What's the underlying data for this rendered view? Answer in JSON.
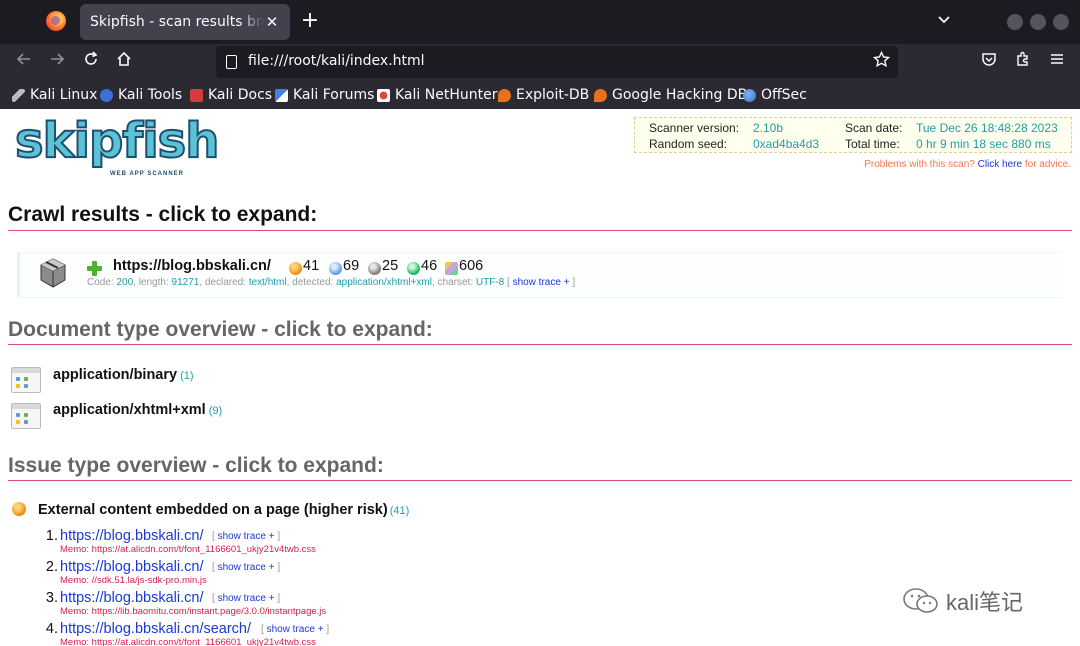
{
  "browser": {
    "tab_title": "Skipfish - scan results browser",
    "tab_close": "✕",
    "new_tab": "+",
    "url": "file:///root/kali/index.html",
    "bookmarks": [
      {
        "label": "Kali Linux",
        "icon": "kali-dragon-icon",
        "color": "#bbbbbb"
      },
      {
        "label": "Kali Tools",
        "icon": "kali-tools-icon",
        "color": "#3f6fd8"
      },
      {
        "label": "Kali Docs",
        "icon": "kali-docs-icon",
        "color": "#d23c3c"
      },
      {
        "label": "Kali Forums",
        "icon": "kali-forums-icon",
        "color": "#4a7fe0"
      },
      {
        "label": "Kali NetHunter",
        "icon": "kali-nethunter-icon",
        "color": "#e0463c"
      },
      {
        "label": "Exploit-DB",
        "icon": "exploit-db-icon",
        "color": "#e8701e"
      },
      {
        "label": "Google Hacking DB",
        "icon": "ghdb-icon",
        "color": "#e8701e"
      },
      {
        "label": "OffSec",
        "icon": "offsec-icon",
        "color": "#4a8fe6"
      }
    ]
  },
  "scan_info": {
    "version_label": "Scanner version:",
    "version": "2.10b",
    "date_label": "Scan date:",
    "date": "Tue Dec 26 18:48:28 2023",
    "seed_label": "Random seed:",
    "seed": "0xad4ba4d3",
    "time_label": "Total time:",
    "time": "0 hr 9 min 18 sec 880 ms",
    "problems_prefix": "Problems with this scan? ",
    "problems_link": "Click here",
    "problems_suffix": " for advice."
  },
  "logo": {
    "word": "skipfish",
    "tagline": "WEB APP SCANNER"
  },
  "sections": {
    "crawl": "Crawl results - click to expand:",
    "doctype": "Document type overview - click to expand:",
    "issue": "Issue type overview - click to expand:"
  },
  "crawl": {
    "url": "https://blog.bbskali.cn/",
    "counts": [
      {
        "value": "41",
        "color": "#f39a1a"
      },
      {
        "value": "69",
        "color": "#6fa7e8"
      },
      {
        "value": "25",
        "color": "#8a8a8a"
      },
      {
        "value": "46",
        "color": "#27c46a"
      },
      {
        "value": "606",
        "color": "#c9a0e0"
      }
    ],
    "meta": {
      "code_label": "Code: ",
      "code": "200",
      "length_label": ", length: ",
      "length": "91271",
      "declared_label": ", declared: ",
      "declared": "text/html",
      "detected_label": ", detected: ",
      "detected": "application/xhtml+xml",
      "charset_label": ", charset: ",
      "charset": "UTF-8",
      "trace_open": " [ ",
      "trace": "show trace +",
      "trace_close": " ]"
    }
  },
  "doc_types": [
    {
      "type": "application/binary",
      "count": "(1)"
    },
    {
      "type": "application/xhtml+xml",
      "count": "(9)"
    }
  ],
  "issue": {
    "title": "External content embedded on a page (higher risk)",
    "count": "(41)",
    "items": [
      {
        "num": "1.",
        "url": "https://blog.bbskali.cn/",
        "trace_open": "[ ",
        "trace": "show trace +",
        "trace_close": " ]",
        "memo": "Memo: https://at.alicdn.com/t/font_1166601_ukjy21v4twb.css"
      },
      {
        "num": "2.",
        "url": "https://blog.bbskali.cn/",
        "trace_open": "[ ",
        "trace": "show trace +",
        "trace_close": " ]",
        "memo": "Memo: //sdk.51.la/js-sdk-pro.min.js"
      },
      {
        "num": "3.",
        "url": "https://blog.bbskali.cn/",
        "trace_open": "[ ",
        "trace": "show trace +",
        "trace_close": " ]",
        "memo": "Memo: https://lib.baomitu.com/instant.page/3.0.0/instantpage.js"
      },
      {
        "num": "4.",
        "url": "https://blog.bbskali.cn/search/",
        "trace_open": "[ ",
        "trace": "show trace +",
        "trace_close": " ]",
        "memo": "Memo: https://at.alicdn.com/t/font_1166601_ukjy21v4twb.css"
      }
    ]
  },
  "watermark": {
    "text": "kali笔记"
  }
}
